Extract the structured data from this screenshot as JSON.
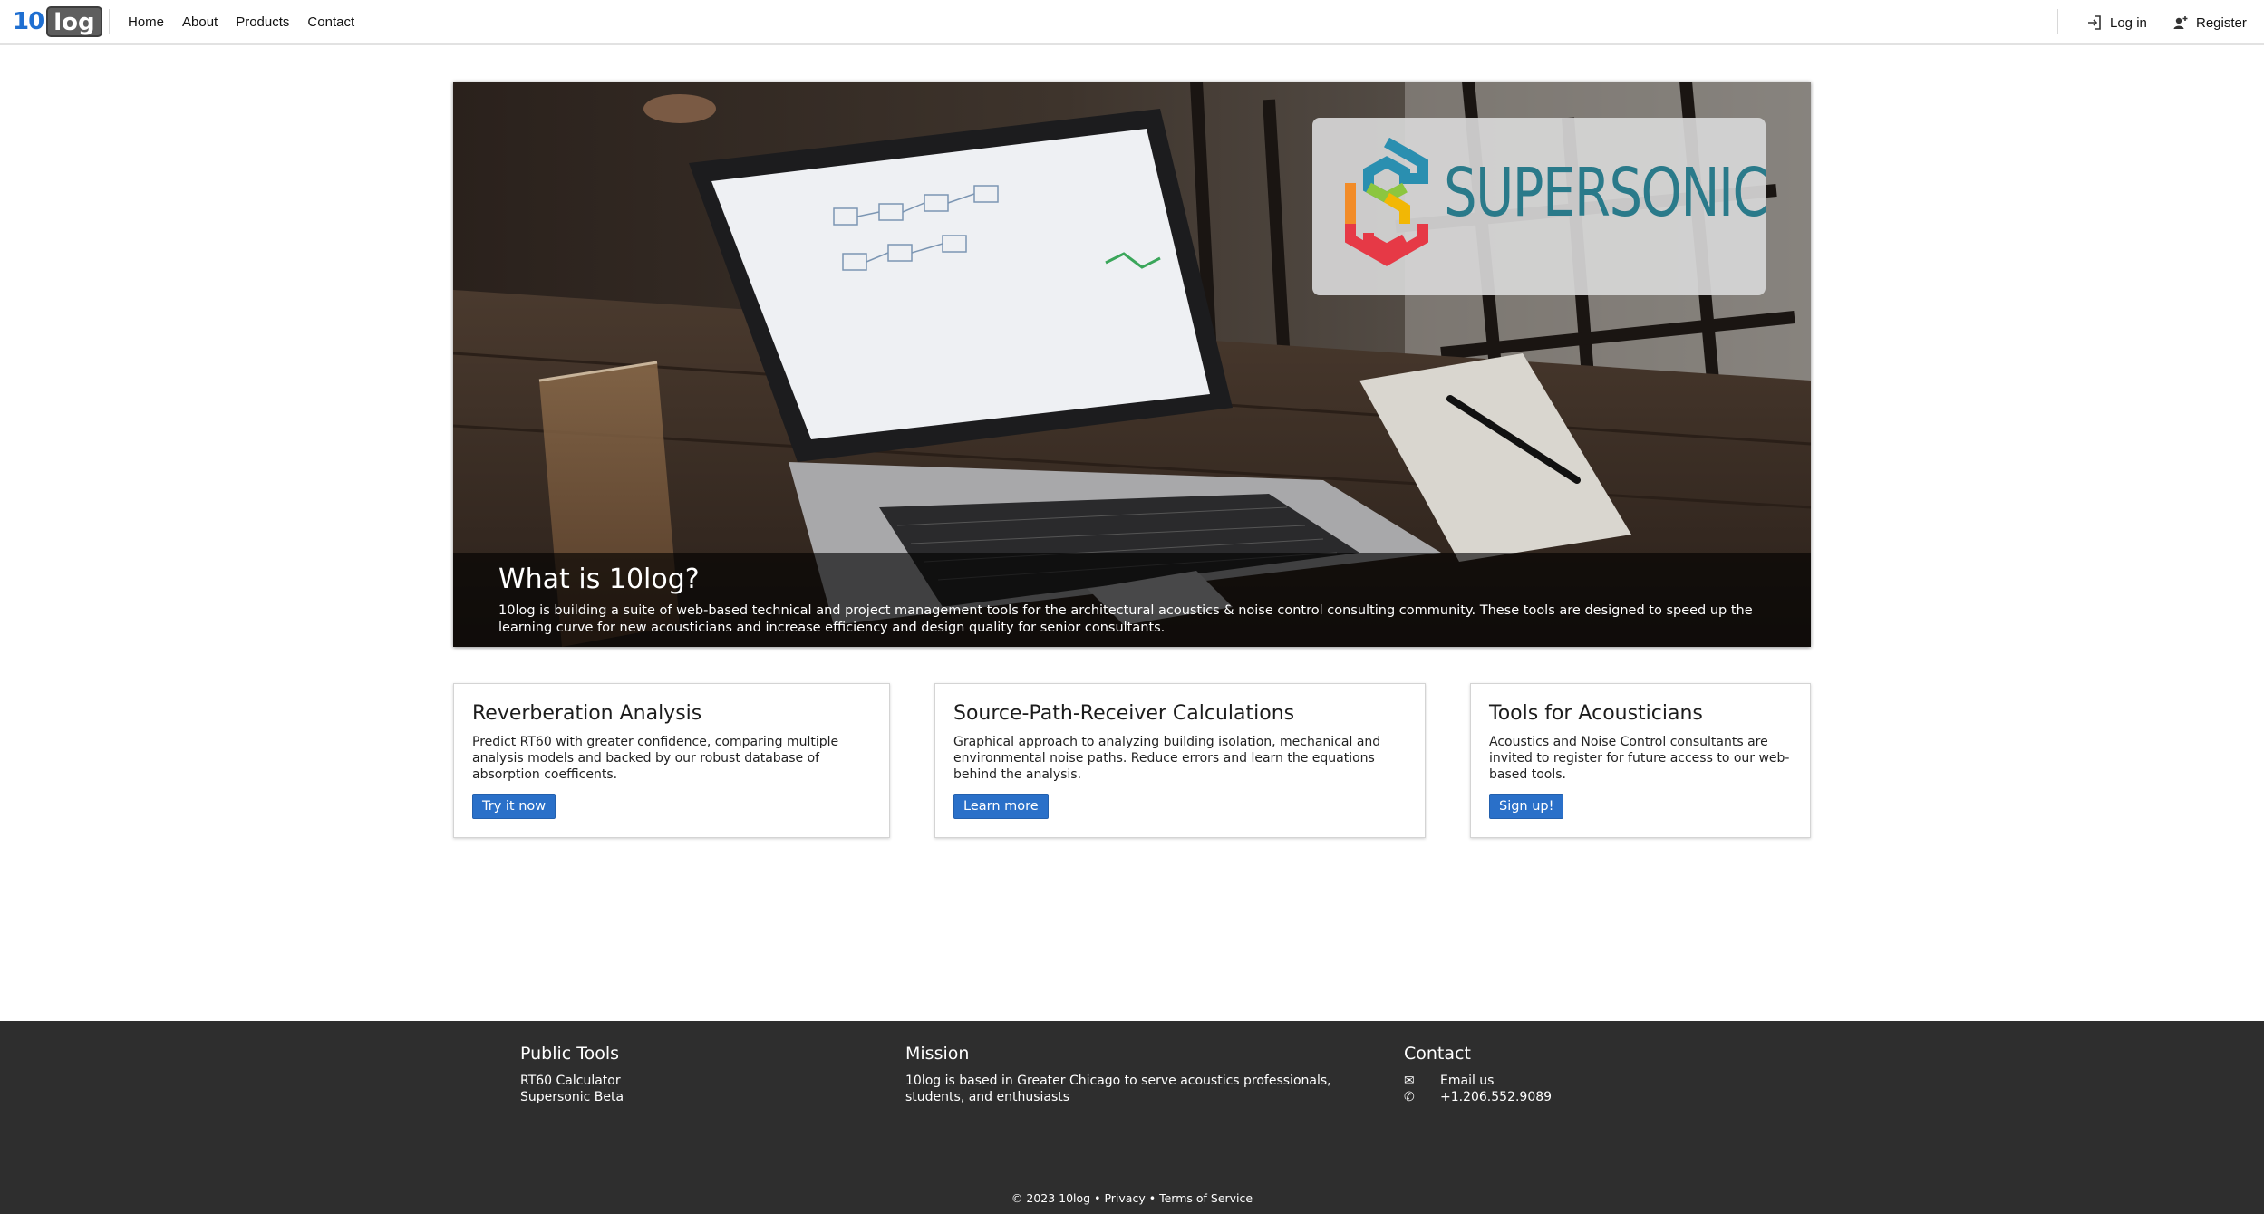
{
  "header": {
    "logo_number": "10",
    "logo_word": "log",
    "nav": [
      "Home",
      "About",
      "Products",
      "Contact"
    ],
    "login_label": "Log in",
    "register_label": "Register"
  },
  "hero": {
    "brand_word": "SUPERSONIC",
    "title": "What is 10log?",
    "text": "10log is building a suite of web-based technical and project management tools for the architectural acoustics & noise control consulting community. These tools are designed to speed up the learning curve for new acousticians and increase efficiency and design quality for senior consultants."
  },
  "cards": [
    {
      "title": "Reverberation Analysis",
      "text": "Predict RT60 with greater confidence, comparing multiple analysis models and backed by our robust database of absorption coefficents.",
      "button": "Try it now"
    },
    {
      "title": "Source-Path-Receiver Calculations",
      "text": "Graphical approach to analyzing building isolation, mechanical and environmental noise paths. Reduce errors and learn the equations behind the analysis.",
      "button": "Learn more"
    },
    {
      "title": "Tools for Acousticians",
      "text": "Acoustics and Noise Control consultants are invited to register for future access to our web-based tools.",
      "button": "Sign up!"
    }
  ],
  "footer": {
    "public_tools": {
      "heading": "Public Tools",
      "links": [
        "RT60 Calculator",
        "Supersonic Beta"
      ]
    },
    "mission": {
      "heading": "Mission",
      "text": "10log is based in Greater Chicago to serve acoustics professionals, students, and enthusiasts"
    },
    "contact": {
      "heading": "Contact",
      "email_label": "Email us",
      "phone": "+1.206.552.9089"
    },
    "copyright": "© 2023 10log",
    "privacy": "Privacy",
    "terms": "Terms of Service"
  },
  "colors": {
    "brand_blue": "#1f6fd1",
    "button_blue": "#2a70c9",
    "footer_bg": "#2e2e2e",
    "supersonic_teal": "#2a7a8a"
  },
  "icons": [
    "login-icon",
    "register-icon",
    "envelope-icon",
    "phone-icon",
    "supersonic-logo-icon"
  ]
}
